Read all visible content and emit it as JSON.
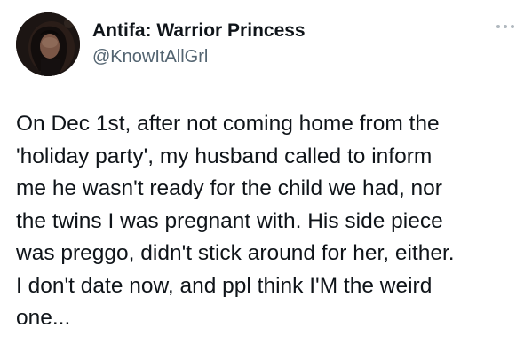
{
  "tweet": {
    "author": {
      "display_name": "Antifa: Warrior Princess",
      "handle": "@KnowItAllGrl",
      "avatar": "profile-photo"
    },
    "more_icon": "more-options-icon",
    "text_lines": [
      "On Dec 1st, after not coming home from the",
      "'holiday party', my husband called to inform",
      "me he wasn't ready for the child we had, nor",
      "the twins I was pregnant with. His side piece",
      "was preggo, didn't stick around for her, either.",
      "I don't date now, and ppl think I'M the weird",
      "one..."
    ],
    "colors": {
      "text": "#0f1419",
      "handle": "#536471",
      "background": "#ffffff"
    }
  }
}
